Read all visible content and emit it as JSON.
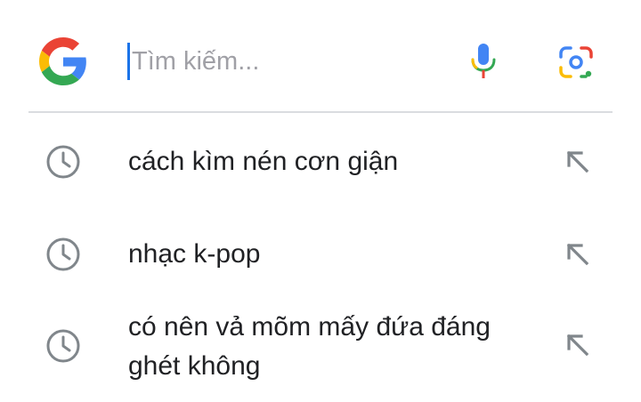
{
  "search": {
    "placeholder": "Tìm kiếm..."
  },
  "icons": {
    "logo": "google-g-icon",
    "voice": "microphone-icon",
    "lens": "camera-lens-icon",
    "history": "clock-icon",
    "fill_query": "arrow-up-left-icon"
  },
  "colors": {
    "blue": "#4285F4",
    "red": "#EA4335",
    "yellow": "#FBBC05",
    "green": "#34A853",
    "icon_gray": "#80868b",
    "text": "#202124"
  },
  "suggestions": [
    {
      "text": "cách kìm nén cơn giận"
    },
    {
      "text": "nhạc k-pop"
    },
    {
      "text": "có nên vả mõm mấy đứa đáng ghét không"
    }
  ]
}
